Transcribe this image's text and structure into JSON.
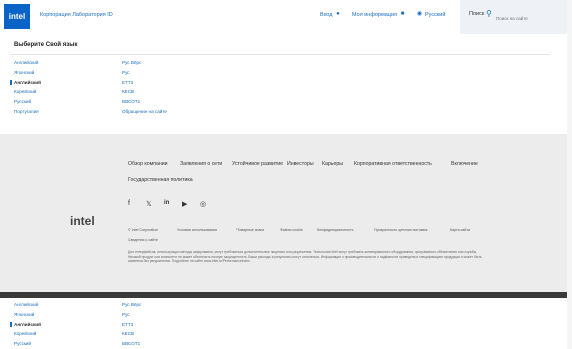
{
  "header": {
    "logo": "intel",
    "title": "Корпорация Лаборатория ID",
    "nav_login": "Вход",
    "nav_account": "Моя информация",
    "nav_lang": "Русский",
    "search_label": "Поиск",
    "search_placeholder": "Поиск на сайте"
  },
  "cookie": {
    "title": "Выберите Свой язык",
    "rows": [
      {
        "label": "Английский",
        "value": "Рус Вёрс"
      },
      {
        "label": "Японский",
        "value": "Рус"
      },
      {
        "label": "Английский",
        "value": "ЕТТ3"
      },
      {
        "label": "Корейский",
        "value": "КЕСВ"
      },
      {
        "label": "Русский",
        "value": "ВВСОТ1"
      },
      {
        "label": "Португалия",
        "value": "Обращение на сайте"
      }
    ],
    "rows2": [
      {
        "label": "Английский",
        "value": "Рус Вёрс"
      },
      {
        "label": "Японский",
        "value": "Рус"
      },
      {
        "label": "Английский",
        "value": "ЕТТ3"
      },
      {
        "label": "Корейский",
        "value": "КЕСВ"
      },
      {
        "label": "Русский",
        "value": "ВВСОТ1"
      }
    ]
  },
  "footer": {
    "logo": "intel",
    "links_row1": [
      "Обзор компании",
      "Заявления о сети",
      "Устойчивое развитие",
      "Инвесторы",
      "Карьеры",
      "Корпоративная ответственность",
      "Включение"
    ],
    "links_row2": [
      "Государственная политика"
    ],
    "legal": [
      "© Intel Corporation",
      "Условия использования",
      "*Товарные знаки",
      "Файлы cookie",
      "Конфиденциальность",
      "Прозрачность цепочки поставок",
      "Карта сайта",
      "Сведения о сайте"
    ],
    "disclaimer": "Для интерфейсов, использующих методы шифрования, могут требоваться дополнительные лицензии или разрешения. Технологии Intel могут требовать активированного оборудования, программного обеспечения или службы. Никакой продукт или компонент не может обеспечить полную защищенность. Ваши расходы и результаты могут отличаться. Информация о производительности и надёжности приведена в спецификациях продукции и может быть изменена без уведомления. Подробнее на сайте www.intel.ru/PerformanceIndex."
  }
}
